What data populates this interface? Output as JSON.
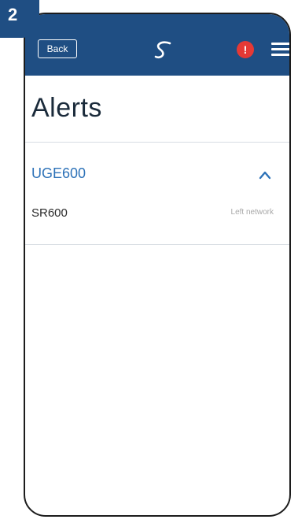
{
  "step": {
    "number": "2"
  },
  "header": {
    "back_label": "Back",
    "logo_icon": "salus-logo-icon",
    "alert_icon": "alert-icon",
    "alert_symbol": "!",
    "menu_icon": "hamburger-menu-icon"
  },
  "page": {
    "title": "Alerts"
  },
  "alerts": {
    "groups": [
      {
        "name": "UGE600",
        "expanded": true,
        "items": [
          {
            "device": "SR600",
            "status": "Left network"
          }
        ]
      }
    ]
  },
  "colors": {
    "brand": "#1f4e83",
    "link": "#2d72b8",
    "alert": "#e53935"
  }
}
